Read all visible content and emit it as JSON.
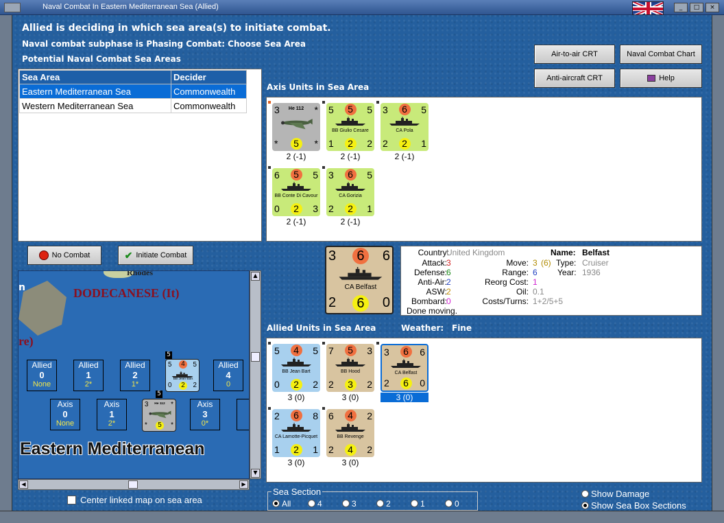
{
  "window": {
    "title": "Naval Combat In Eastern Mediterranean Sea (Allied)"
  },
  "header": {
    "line1": "Allied is deciding in which sea area(s) to initiate combat.",
    "line2": "Naval combat subphase is Phasing Combat: Choose Sea Area",
    "line3": "Potential Naval Combat Sea Areas"
  },
  "buttons": {
    "air_to_air": "Air-to-air CRT",
    "naval_chart": "Naval Combat Chart",
    "anti_aircraft": "Anti-aircraft CRT",
    "help": "Help",
    "no_combat": "No Combat",
    "initiate": "Initiate Combat"
  },
  "table": {
    "headers": [
      "Sea Area",
      "Decider"
    ],
    "rows": [
      [
        "Eastern Mediterranean Sea",
        "Commonwealth"
      ],
      [
        "Western Mediterranean Sea",
        "Commonwealth"
      ]
    ]
  },
  "axis_section": {
    "label": "Axis Units in Sea Area",
    "units": [
      {
        "tl": "3",
        "tr": "*",
        "top": "",
        "name": "He 112",
        "bl": "*",
        "br": "*",
        "bottom": "5",
        "caption": "2 (-1)",
        "kind": "air",
        "color": "#b5b5b5"
      },
      {
        "tl": "5",
        "tr": "5",
        "top": "5",
        "name": "BB Giulio Cesare",
        "bl": "1",
        "br": "2",
        "bottom": "2",
        "caption": "2 (-1)",
        "kind": "ship",
        "color": "#c8ea7a"
      },
      {
        "tl": "3",
        "tr": "5",
        "top": "6",
        "name": "CA Pola",
        "bl": "2",
        "br": "1",
        "bottom": "2",
        "caption": "2 (-1)",
        "kind": "ship",
        "color": "#c8ea7a"
      },
      {
        "tl": "6",
        "tr": "5",
        "top": "5",
        "name": "BB Conte Di Cavour",
        "bl": "0",
        "br": "3",
        "bottom": "2",
        "caption": "2 (-1)",
        "kind": "ship",
        "color": "#c8ea7a"
      },
      {
        "tl": "3",
        "tr": "5",
        "top": "6",
        "name": "CA Gorizia",
        "bl": "2",
        "br": "1",
        "bottom": "2",
        "caption": "2 (-1)",
        "kind": "ship",
        "color": "#c8ea7a"
      }
    ]
  },
  "allied_section": {
    "label": "Allied Units in Sea Area",
    "weather_label": "Weather:",
    "weather": "Fine",
    "units": [
      {
        "tl": "5",
        "tr": "5",
        "top": "4",
        "name": "BB Jean Bart",
        "bl": "0",
        "br": "2",
        "bottom": "2",
        "caption": "3 (0)",
        "color": "#a8d0ee"
      },
      {
        "tl": "7",
        "tr": "3",
        "top": "5",
        "name": "BB Hood",
        "bl": "2",
        "br": "2",
        "bottom": "3",
        "caption": "3 (0)",
        "color": "#d8c4a0"
      },
      {
        "tl": "3",
        "tr": "6",
        "top": "6",
        "name": "CA Belfast",
        "bl": "2",
        "br": "0",
        "bottom": "6",
        "caption": "3 (0)",
        "color": "#d8c4a0",
        "selected": true
      },
      {
        "tl": "2",
        "tr": "8",
        "top": "6",
        "name": "CA Lamotte-Picquet",
        "bl": "1",
        "br": "1",
        "bottom": "2",
        "caption": "3 (0)",
        "color": "#a8d0ee"
      },
      {
        "tl": "6",
        "tr": "2",
        "top": "4",
        "name": "BB Revenge",
        "bl": "2",
        "br": "2",
        "bottom": "4",
        "caption": "3 (0)",
        "color": "#d8c4a0"
      }
    ]
  },
  "big_unit": {
    "tl": "3",
    "tr": "6",
    "top": "6",
    "name": "CA Belfast",
    "bl": "2",
    "br": "0",
    "bottom": "6"
  },
  "info": {
    "country_l": "Country:",
    "country": "United Kingdom",
    "attack_l": "Attack:",
    "attack": "3",
    "defense_l": "Defense:",
    "defense": "6",
    "aa_l": "Anti-Air:",
    "aa": "2",
    "asw_l": "ASW:",
    "asw": "2",
    "bomb_l": "Bombard:",
    "bomb": "0",
    "status": "Done moving.",
    "name_l": "Name:",
    "name": "Belfast",
    "move_l": "Move:",
    "move": "3",
    "move_ext": "(6)",
    "type_l": "Type:",
    "type": "Cruiser",
    "range_l": "Range:",
    "range": "6",
    "year_l": "Year:",
    "year": "1936",
    "reorg_l": "Reorg Cost:",
    "reorg": "1",
    "oil_l": "Oil:",
    "oil": "0.1",
    "cost_l": "Costs/Turns:",
    "cost": "1+2/5+5"
  },
  "map": {
    "rhodes": "Rhodes",
    "dodecanese": "DODECANESE (It)",
    "letter_n": "n",
    "re": "re)",
    "sea_name": "Eastern Mediterranean",
    "allied_boxes": [
      {
        "a": "Allied",
        "b": "0",
        "c": "None"
      },
      {
        "a": "Allied",
        "b": "1",
        "c": "2*"
      },
      {
        "a": "Allied",
        "b": "2",
        "c": "1*"
      },
      {
        "a": "Allied",
        "b": "4",
        "c": "0"
      }
    ],
    "axis_boxes": [
      {
        "a": "Axis",
        "b": "0",
        "c": "None"
      },
      {
        "a": "Axis",
        "b": "1",
        "c": "2*"
      },
      {
        "a": "Axis",
        "b": "3",
        "c": "0*"
      },
      {
        "a": "A",
        "b": "",
        "c": ""
      }
    ],
    "stack_count_allied": "5",
    "stack_count_axis": "5",
    "mini_ship": {
      "tl": "5",
      "tr": "5",
      "top": "4",
      "name": "BB Jean Bart",
      "bl": "0",
      "br": "2",
      "bottom": "2"
    },
    "mini_air": {
      "tl": "3",
      "tr": "*",
      "name": "He 112",
      "bl": "*",
      "br": "*",
      "bottom": "5"
    },
    "center_label": "Center linked map on sea area"
  },
  "sea_section": {
    "label": "Sea Section",
    "options": [
      "All",
      "4",
      "3",
      "2",
      "1",
      "0"
    ]
  },
  "show": {
    "damage": "Show Damage",
    "sections": "Show Sea Box Sections"
  }
}
